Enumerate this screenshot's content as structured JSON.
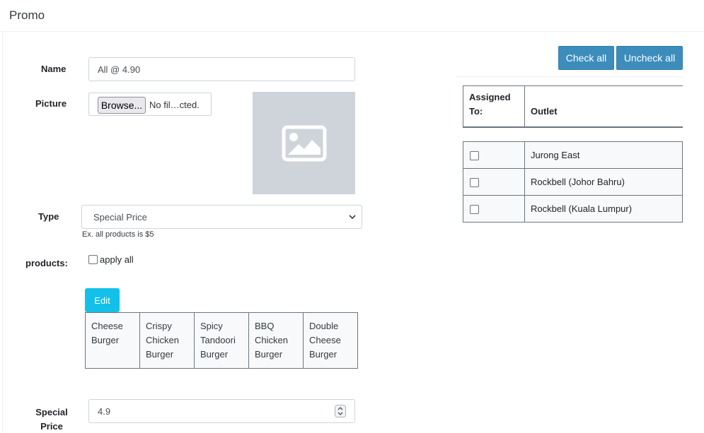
{
  "header": {
    "title": "Promo"
  },
  "form": {
    "name_label": "Name",
    "name_value": "All @ 4.90",
    "picture_label": "Picture",
    "browse_label": "Browse...",
    "file_status": "No fil…cted.",
    "picture_icon": "image-placeholder-icon",
    "type_label": "Type",
    "type_selected": "Special Price",
    "type_hint": "Ex. all products is $5",
    "products_label": "products:",
    "apply_all_label": "apply all",
    "apply_all_checked": false,
    "edit_label": "Edit",
    "products": [
      "Cheese Burger",
      "Crispy Chicken Burger",
      "Spicy Tandoori Burger",
      "BBQ Chicken Burger",
      "Double Cheese Burger"
    ],
    "special_price_label": "Special Price",
    "special_price_value": "4.9"
  },
  "outlets": {
    "check_all_label": "Check all",
    "uncheck_all_label": "Uncheck all",
    "col_assigned": "Assigned To:",
    "col_outlet": "Outlet",
    "rows": [
      {
        "name": "Jurong East",
        "checked": false
      },
      {
        "name": "Rockbell (Johor Bahru)",
        "checked": false
      },
      {
        "name": "Rockbell (Kuala Lumpur)",
        "checked": false
      }
    ]
  },
  "colors": {
    "primary_button": "#3c8dbc",
    "info_button": "#13c0ea",
    "placeholder_bg": "#ced4da"
  }
}
